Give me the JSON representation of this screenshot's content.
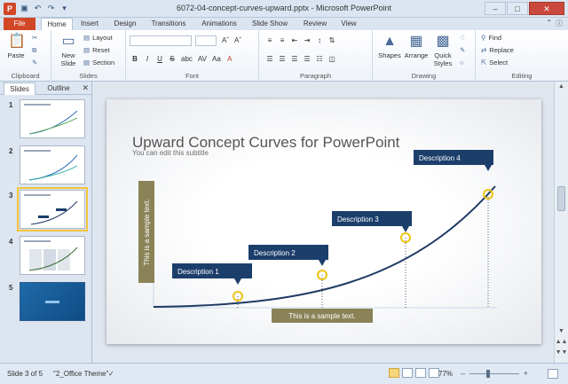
{
  "window": {
    "title": "6072-04-concept-curves-upward.pptx - Microsoft PowerPoint",
    "app_icon": "P",
    "qat_icons": [
      "save-icon",
      "undo-icon",
      "redo-icon",
      "customize-icon"
    ],
    "controls": [
      "minimize",
      "maximize",
      "close"
    ]
  },
  "ribbon": {
    "tabs": [
      "File",
      "Home",
      "Insert",
      "Design",
      "Transitions",
      "Animations",
      "Slide Show",
      "Review",
      "View"
    ],
    "active_tab": "Home",
    "groups": {
      "clipboard": {
        "label": "Clipboard",
        "paste": "Paste"
      },
      "slides": {
        "label": "Slides",
        "new_slide": "New Slide",
        "layout": "Layout",
        "reset": "Reset",
        "section": "Section"
      },
      "font": {
        "label": "Font",
        "bold": "B",
        "italic": "I",
        "underline": "U",
        "strike": "S",
        "shadow": "abc",
        "spacing": "AV",
        "case": "Aa",
        "color": "A"
      },
      "paragraph": {
        "label": "Paragraph"
      },
      "drawing": {
        "label": "Drawing",
        "shapes": "Shapes",
        "arrange": "Arrange",
        "quick_styles": "Quick Styles"
      },
      "editing": {
        "label": "Editing",
        "find": "Find",
        "replace": "Replace",
        "select": "Select"
      }
    }
  },
  "left_pane": {
    "tabs": [
      "Slides",
      "Outline"
    ],
    "active_tab": "Slides",
    "slides": [
      {
        "number": "1"
      },
      {
        "number": "2"
      },
      {
        "number": "3",
        "selected": true
      },
      {
        "number": "4"
      },
      {
        "number": "5"
      }
    ]
  },
  "slide": {
    "title": "Upward Concept Curves for PowerPoint",
    "subtitle": "You can edit this subtitle",
    "y_label": "This is a sample text.",
    "x_label": "This is a sample text.",
    "descriptions": [
      "Description 1",
      "Description 2",
      "Description 3",
      "Description 4"
    ],
    "colors": {
      "curve": "#1f3a64",
      "label_box": "#1c3e6b",
      "axis_box": "#8a8357",
      "marker": "#f0c419"
    }
  },
  "status": {
    "slide_info": "Slide 3 of 5",
    "theme": "\"2_Office Theme\"",
    "zoom": "77%",
    "zoom_level": 0.77
  }
}
